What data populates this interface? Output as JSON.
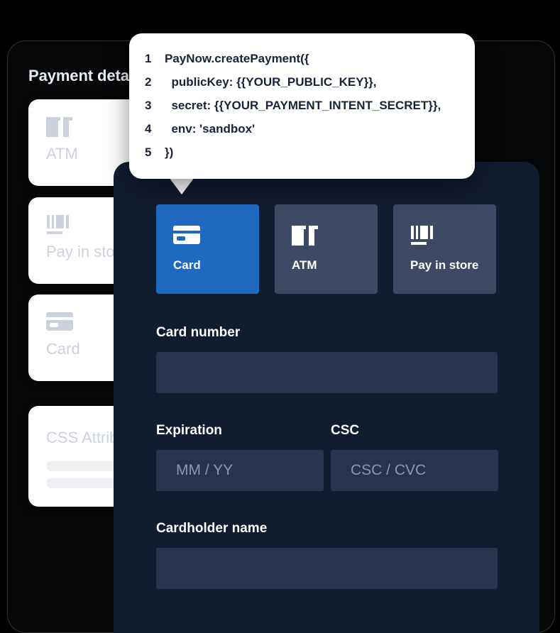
{
  "background_panel": {
    "title": "Payment details",
    "cards": [
      {
        "label": "ATM",
        "icon": "banknotes-icon"
      },
      {
        "label": "Pay in store",
        "icon": "barcode-icon"
      },
      {
        "label": "Card",
        "icon": "credit-card-icon"
      },
      {
        "label": "CSS Attributes",
        "icon": "none"
      }
    ]
  },
  "tooltip": {
    "lines": [
      {
        "num": "1",
        "text": "PayNow.createPayment({"
      },
      {
        "num": "2",
        "text": "  publicKey: {{YOUR_PUBLIC_KEY}},"
      },
      {
        "num": "3",
        "text": "  secret: {{YOUR_PAYMENT_INTENT_SECRET}},"
      },
      {
        "num": "4",
        "text": "  env: 'sandbox'"
      },
      {
        "num": "5",
        "text": "})"
      }
    ]
  },
  "widget": {
    "tabs": [
      {
        "label": "Card",
        "icon": "credit-card-icon",
        "selected": true
      },
      {
        "label": "ATM",
        "icon": "banknotes-icon",
        "selected": false
      },
      {
        "label": "Pay in store",
        "icon": "barcode-icon",
        "selected": false
      }
    ],
    "fields": {
      "card_number": {
        "label": "Card number",
        "value": "",
        "placeholder": ""
      },
      "expiration": {
        "label": "Expiration",
        "value": "",
        "placeholder": "MM / YY"
      },
      "csc": {
        "label": "CSC",
        "value": "",
        "placeholder": "CSC / CVC"
      },
      "cardholder_name": {
        "label": "Cardholder name",
        "value": "",
        "placeholder": ""
      }
    }
  },
  "colors": {
    "widget_bg": "#121c2f",
    "tab_active": "#2069c0",
    "tab_inactive": "#3e4a63",
    "input_bg": "#28344e",
    "placeholder": "#8d97ab",
    "panel_bg": "#050608",
    "card_white": "#ffffff",
    "ghost_text": "#ccd2dd"
  }
}
